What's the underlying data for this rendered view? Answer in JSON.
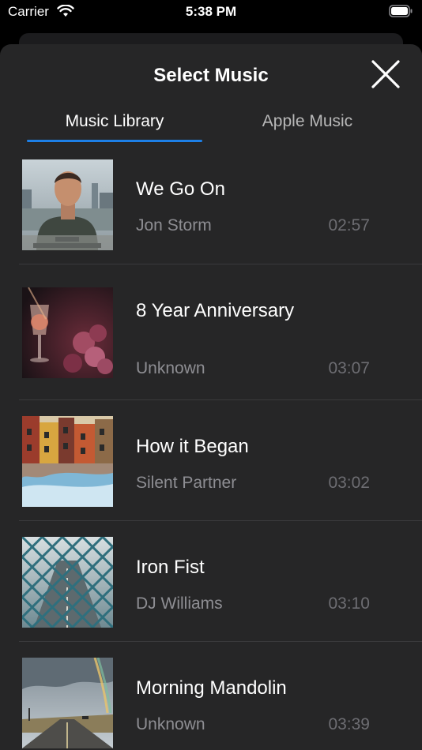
{
  "status_bar": {
    "carrier": "Carrier",
    "time": "5:38 PM"
  },
  "sheet": {
    "title": "Select Music"
  },
  "tabs": [
    {
      "label": "Music Library",
      "selected": true
    },
    {
      "label": "Apple Music",
      "selected": false
    }
  ],
  "tracks": [
    {
      "title": "We Go On",
      "artist": "Jon Storm",
      "duration": "02:57",
      "art": "portrait-man"
    },
    {
      "title": "8 Year Anniversary",
      "artist": "Unknown",
      "duration": "03:07",
      "art": "wine-roses"
    },
    {
      "title": "How it Began",
      "artist": "Silent Partner",
      "duration": "03:02",
      "art": "buildings-reflection"
    },
    {
      "title": "Iron Fist",
      "artist": "DJ Williams",
      "duration": "03:10",
      "art": "chain-fence-road"
    },
    {
      "title": "Morning Mandolin",
      "artist": "Unknown",
      "duration": "03:39",
      "art": "road-sky-rainbow"
    }
  ],
  "colors": {
    "accent": "#1d7fe6",
    "sheet_bg": "#262627",
    "secondary_text": "#8e8e93"
  }
}
